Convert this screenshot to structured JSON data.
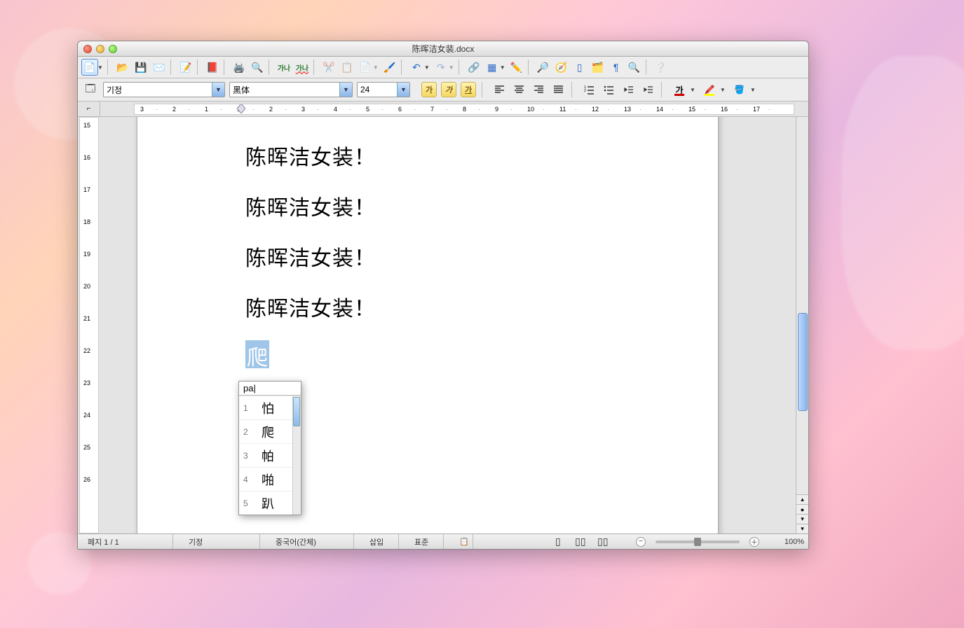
{
  "window": {
    "title": "陈晖洁女装.docx"
  },
  "toolbar2": {
    "paragraph_style": "기정",
    "font_name": "黑体",
    "font_size": "24"
  },
  "ruler": {
    "h_labels": [
      "3",
      "2",
      "1",
      "1",
      "2",
      "3",
      "4",
      "5",
      "6",
      "7",
      "8",
      "9",
      "10",
      "11",
      "12",
      "13",
      "14",
      "15",
      "16",
      "17"
    ],
    "v_labels": [
      "15",
      "16",
      "17",
      "18",
      "19",
      "20",
      "21",
      "22",
      "23",
      "24",
      "25",
      "26"
    ]
  },
  "document": {
    "lines": [
      "陈晖洁女装！",
      "陈晖洁女装！",
      "陈晖洁女装！",
      "陈晖洁女装！"
    ],
    "preedit": "爬"
  },
  "ime": {
    "input": "pa",
    "candidates": [
      {
        "n": "1",
        "ch": "怕"
      },
      {
        "n": "2",
        "ch": "爬"
      },
      {
        "n": "3",
        "ch": "帕"
      },
      {
        "n": "4",
        "ch": "啪"
      },
      {
        "n": "5",
        "ch": "趴"
      }
    ],
    "selected_index": 1
  },
  "statusbar": {
    "page": "페지  1 / 1",
    "style": "기정",
    "language": "중국어(간체)",
    "insert": "삽입",
    "standard": "표준",
    "zoom": "100%"
  }
}
